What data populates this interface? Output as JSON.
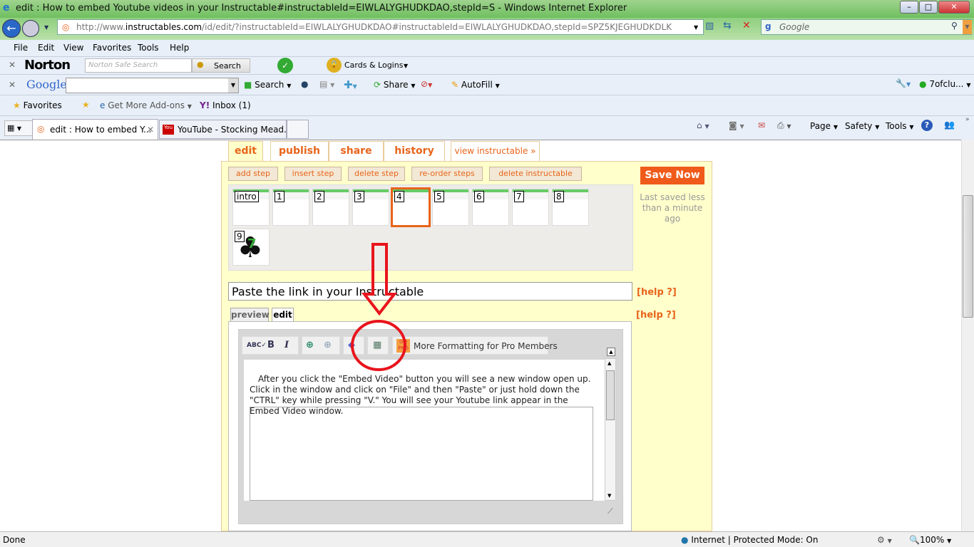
{
  "window": {
    "title": "edit : How to embed Youtube videos in your Instructable#instructableId=EIWLALYGHUDKDAO,stepId=S - Windows Internet Explorer"
  },
  "address": {
    "prefix": "http://www.",
    "domain": "instructables.com",
    "path": "/id/edit/?instructableId=EIWLALYGHUDKDAO#instructableId=EIWLALYGHUDKDAO,stepId=SPZ5KJEGHUDKDLK"
  },
  "search": {
    "placeholder": "Google"
  },
  "menu": [
    "File",
    "Edit",
    "View",
    "Favorites",
    "Tools",
    "Help"
  ],
  "norton": {
    "brand": "Norton",
    "placeholder": "Norton Safe Search",
    "search": "Search",
    "cards": "Cards & Logins"
  },
  "google_bar": {
    "brand": "Google",
    "search": "Search",
    "share": "Share",
    "autofill": "AutoFill",
    "user": "7ofclu..."
  },
  "favorites": {
    "label": "Favorites",
    "addons": "Get More Add-ons",
    "inbox": "Inbox (1)"
  },
  "tabs": [
    {
      "label": "edit : How to embed Y..."
    },
    {
      "label": "YouTube - Stocking Mead..."
    }
  ],
  "command_bar": {
    "page": "Page",
    "safety": "Safety",
    "tools": "Tools"
  },
  "site": {
    "tabs": [
      "edit",
      "publish",
      "share",
      "history"
    ],
    "view_link": "view instructable »",
    "buttons": [
      "add step",
      "insert step",
      "delete step",
      "re-order steps",
      "delete instructable"
    ],
    "save": "Save Now",
    "saved_status": "Last saved less than a minute ago",
    "steps": [
      "intro",
      "1",
      "2",
      "3",
      "4",
      "5",
      "6",
      "7",
      "8",
      "9"
    ],
    "selected_step": "4",
    "step_title": "Paste the link in your Instructable",
    "help": "[help ?]",
    "editor_tabs": [
      "preview",
      "edit"
    ],
    "pro_formatting": "More Formatting for Pro Members",
    "body_text": "After you click the \"Embed Video\" button you will see a new window open up.  Click in the window and click on \"File\" and then \"Paste\" or just hold down the \"CTRL\" key while pressing \"V.\"  You will see your Youtube link appear in the Embed Video window."
  },
  "annotation_color": "#e8141c",
  "status": {
    "left": "Done",
    "zone": "Internet | Protected Mode: On",
    "zoom": "100%"
  }
}
